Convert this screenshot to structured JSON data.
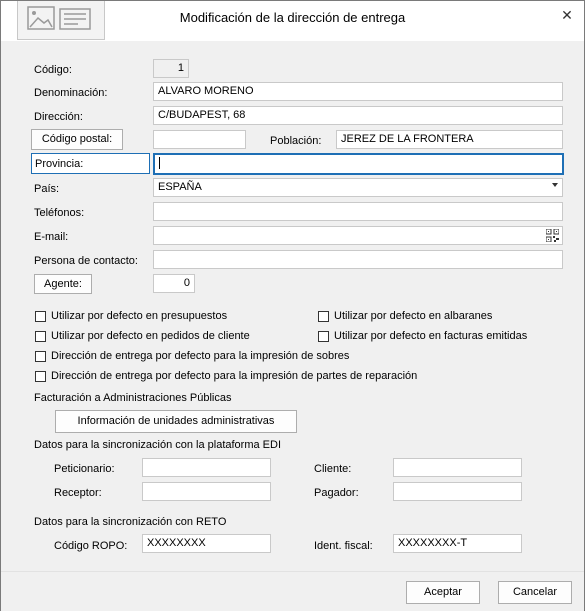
{
  "window": {
    "title": "Modificación de la dirección de entrega",
    "close": "✕"
  },
  "fields": {
    "codigo_label": "Código:",
    "codigo_value": "1",
    "denominacion_label": "Denominación:",
    "denominacion_value": "ALVARO MORENO",
    "direccion_label": "Dirección:",
    "direccion_value": "C/BUDAPEST, 68",
    "codigo_postal_button": "Código postal:",
    "codigo_postal_value": "",
    "poblacion_label": "Población:",
    "poblacion_value": "JEREZ DE LA FRONTERA",
    "provincia_label": "Provincia:",
    "provincia_value": "",
    "pais_label": "País:",
    "pais_value": "ESPAÑA",
    "telefonos_label": "Teléfonos:",
    "telefonos_value": "",
    "email_label": "E-mail:",
    "email_value": "",
    "contacto_label": "Persona de contacto:",
    "contacto_value": "",
    "agente_button": "Agente:",
    "agente_value": "0"
  },
  "checkboxes": {
    "presupuestos": {
      "label": "Utilizar por defecto en presupuestos",
      "checked": false
    },
    "albaranes": {
      "label": "Utilizar por defecto en albaranes",
      "checked": false
    },
    "pedidos": {
      "label": "Utilizar por defecto en pedidos de cliente",
      "checked": false
    },
    "facturas": {
      "label": "Utilizar por defecto en facturas emitidas",
      "checked": false
    },
    "sobres": {
      "label": "Dirección de entrega por defecto para la impresión de sobres",
      "checked": false
    },
    "partes": {
      "label": "Dirección de entrega por defecto para la impresión de partes de reparación",
      "checked": false
    }
  },
  "admin": {
    "section_label": "Facturación a Administraciones Públicas",
    "button": "Información de unidades administrativas"
  },
  "edi": {
    "section_label": "Datos para la sincronización con la plataforma EDI",
    "peticionario_label": "Peticionario:",
    "peticionario_value": "",
    "cliente_label": "Cliente:",
    "cliente_value": "",
    "receptor_label": "Receptor:",
    "receptor_value": "",
    "pagador_label": "Pagador:",
    "pagador_value": ""
  },
  "reto": {
    "section_label": "Datos para la sincronización con RETO",
    "ropo_label": "Código ROPO:",
    "ropo_value": "XXXXXXXX",
    "ident_label": "Ident. fiscal:",
    "ident_value": "XXXXXXXX-T"
  },
  "footer": {
    "accept": "Aceptar",
    "cancel": "Cancelar"
  },
  "icons": [
    "logo-image-icon",
    "close-icon",
    "dropdown-arrow-icon",
    "qr-code-icon"
  ]
}
